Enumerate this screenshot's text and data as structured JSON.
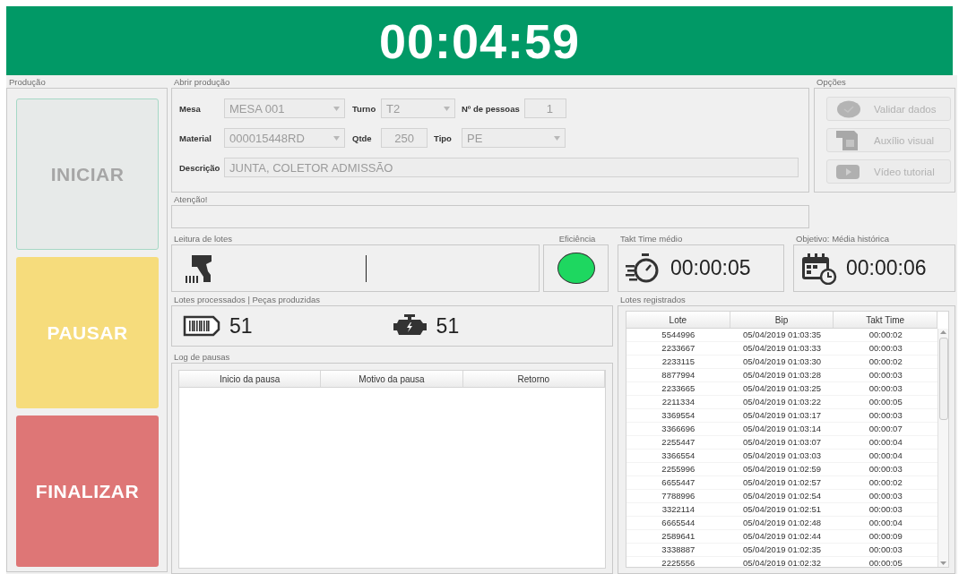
{
  "timer": "00:04:59",
  "producao": {
    "title": "Produção",
    "buttons": [
      {
        "label": "INICIAR",
        "kind": "start",
        "disabled": true
      },
      {
        "label": "PAUSAR",
        "kind": "pause",
        "disabled": false
      },
      {
        "label": "FINALIZAR",
        "kind": "finish",
        "disabled": false
      }
    ]
  },
  "abrir_producao": {
    "title": "Abrir produção",
    "mesa": {
      "label": "Mesa",
      "value": "MESA 001"
    },
    "turno": {
      "label": "Turno",
      "value": "T2"
    },
    "pessoas": {
      "label": "Nº de pessoas",
      "value": "1"
    },
    "material": {
      "label": "Material",
      "value": "000015448RD"
    },
    "qtde": {
      "label": "Qtde",
      "value": "250"
    },
    "tipo": {
      "label": "Tipo",
      "value": "PE"
    },
    "descricao": {
      "label": "Descrição",
      "value": "JUNTA, COLETOR ADMISSÃO"
    }
  },
  "atencao": {
    "title": "Atenção!"
  },
  "opcoes": {
    "title": "Opções",
    "buttons": [
      {
        "label": "Validar dados",
        "kind": "validate",
        "disabled": true
      },
      {
        "label": "Auxílio visual",
        "kind": "visual",
        "disabled": true
      },
      {
        "label": "Vídeo tutorial",
        "kind": "video",
        "disabled": true
      }
    ]
  },
  "leitura": {
    "title": "Leitura de lotes"
  },
  "eficiencia": {
    "title": "Eficiência",
    "color": "#1ed760"
  },
  "takt_medio": {
    "title": "Takt Time médio",
    "value": "00:00:05"
  },
  "objetivo": {
    "title": "Objetivo: Média histórica",
    "value": "00:00:06"
  },
  "contadores": {
    "title": "Lotes processados | Peças produzidas",
    "lotes": "51",
    "pecas": "51"
  },
  "log_pausas": {
    "title": "Log de pausas",
    "columns": [
      "Inicio da pausa",
      "Motivo da pausa",
      "Retorno"
    ]
  },
  "lotes_registrados": {
    "title": "Lotes registrados",
    "columns": [
      "Lote",
      "Bip",
      "Takt Time"
    ],
    "rows": [
      [
        "5544996",
        "05/04/2019 01:03:35",
        "00:00:02"
      ],
      [
        "2233667",
        "05/04/2019 01:03:33",
        "00:00:03"
      ],
      [
        "2233115",
        "05/04/2019 01:03:30",
        "00:00:02"
      ],
      [
        "8877994",
        "05/04/2019 01:03:28",
        "00:00:03"
      ],
      [
        "2233665",
        "05/04/2019 01:03:25",
        "00:00:03"
      ],
      [
        "2211334",
        "05/04/2019 01:03:22",
        "00:00:05"
      ],
      [
        "3369554",
        "05/04/2019 01:03:17",
        "00:00:03"
      ],
      [
        "3366696",
        "05/04/2019 01:03:14",
        "00:00:07"
      ],
      [
        "2255447",
        "05/04/2019 01:03:07",
        "00:00:04"
      ],
      [
        "3366554",
        "05/04/2019 01:03:03",
        "00:00:04"
      ],
      [
        "2255996",
        "05/04/2019 01:02:59",
        "00:00:03"
      ],
      [
        "6655447",
        "05/04/2019 01:02:57",
        "00:00:02"
      ],
      [
        "7788996",
        "05/04/2019 01:02:54",
        "00:00:03"
      ],
      [
        "3322114",
        "05/04/2019 01:02:51",
        "00:00:03"
      ],
      [
        "6665544",
        "05/04/2019 01:02:48",
        "00:00:04"
      ],
      [
        "2589641",
        "05/04/2019 01:02:44",
        "00:00:09"
      ],
      [
        "3338887",
        "05/04/2019 01:02:35",
        "00:00:03"
      ],
      [
        "2225556",
        "05/04/2019 01:02:32",
        "00:00:05"
      ]
    ]
  }
}
